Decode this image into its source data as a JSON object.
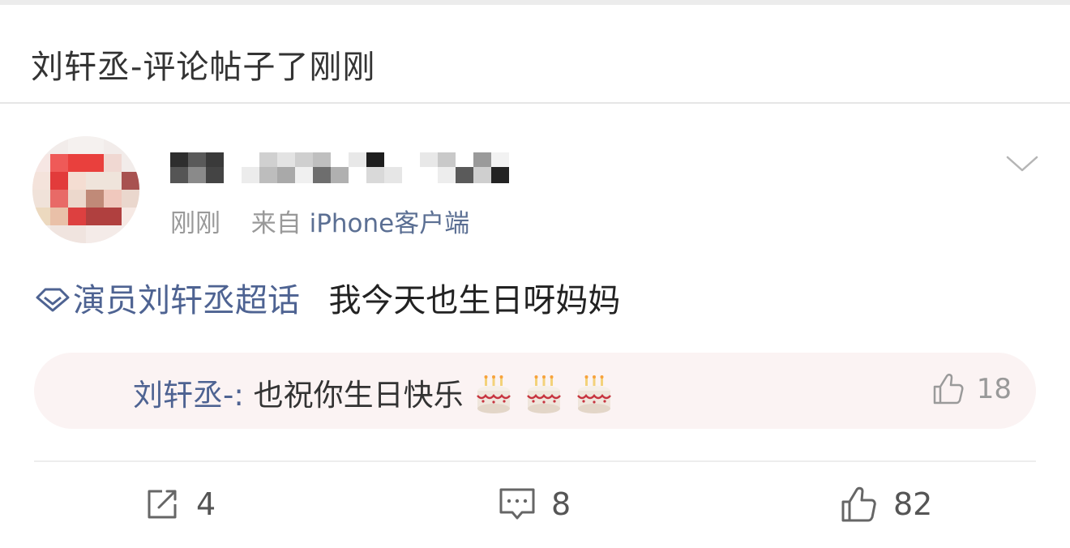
{
  "header": {
    "title": "刘轩丞-评论帖子了刚刚"
  },
  "post": {
    "time": "刚刚",
    "source_prefix": "来自",
    "source": "iPhone客户端",
    "topic": "演员刘轩丞超话",
    "text": "我今天也生日呀妈妈"
  },
  "reply": {
    "author": "刘轩丞-:",
    "text": "也祝你生日快乐",
    "emoji": "birthday-cake-icon",
    "likes": "18"
  },
  "actions": {
    "repost_count": "4",
    "comment_count": "8",
    "like_count": "82"
  },
  "colors": {
    "link": "#4e6392",
    "reply_bg": "#fbf3f3",
    "muted": "#999999"
  }
}
